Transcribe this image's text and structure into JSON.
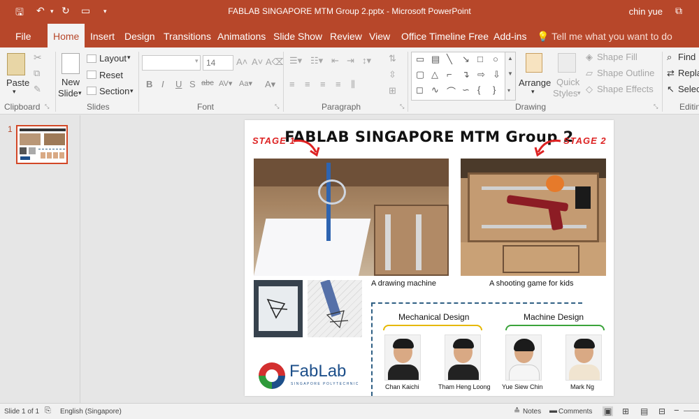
{
  "window": {
    "title": "FABLAB SINGAPORE  MTM Group 2.pptx - Microsoft PowerPoint",
    "user": "chin yue"
  },
  "tabs": [
    "File",
    "Home",
    "Insert",
    "Design",
    "Transitions",
    "Animations",
    "Slide Show",
    "Review",
    "View",
    "Office Timeline Free",
    "Add-ins"
  ],
  "tell_me": "Tell me what you want to do",
  "ribbon": {
    "clipboard": {
      "paste": "Paste",
      "label": "Clipboard"
    },
    "slides": {
      "new_slide_1": "New",
      "new_slide_2": "Slide",
      "layout": "Layout",
      "reset": "Reset",
      "section": "Section",
      "label": "Slides"
    },
    "font": {
      "font_size": "14",
      "label": "Font"
    },
    "paragraph": {
      "label": "Paragraph"
    },
    "drawing": {
      "arrange": "Arrange",
      "quick_styles_1": "Quick",
      "quick_styles_2": "Styles",
      "shape_fill": "Shape Fill",
      "shape_outline": "Shape Outline",
      "shape_effects": "Shape Effects",
      "label": "Drawing"
    },
    "editing": {
      "find": "Find",
      "replace": "Repla",
      "select": "Selec",
      "label": "Editin"
    }
  },
  "slide_panel": {
    "slide_number": "1"
  },
  "slide": {
    "title": "FABLAB SINGAPORE  MTM Group 2",
    "stage1": "STAGE 1",
    "stage2": "STAGE 2",
    "caption1": "A drawing machine",
    "caption2": "A shooting game for kids",
    "team1": "Mechanical Design",
    "team2": "Machine Design",
    "members": [
      "Chan Kaichi",
      "Tham Heng Loong",
      "Yue Siew Chin",
      "Mark Ng"
    ],
    "logo_text": "FabLab",
    "logo_sub": "SINGAPORE POLYTECHNIC"
  },
  "status": {
    "slide_info": "Slide 1 of 1",
    "language": "English (Singapore)",
    "notes": "Notes",
    "comments": "Comments"
  },
  "colors": {
    "accent": "#b7472a",
    "stage_red": "#d22222",
    "mech_brace": "#e6b800",
    "machine_brace": "#3aa33a"
  }
}
